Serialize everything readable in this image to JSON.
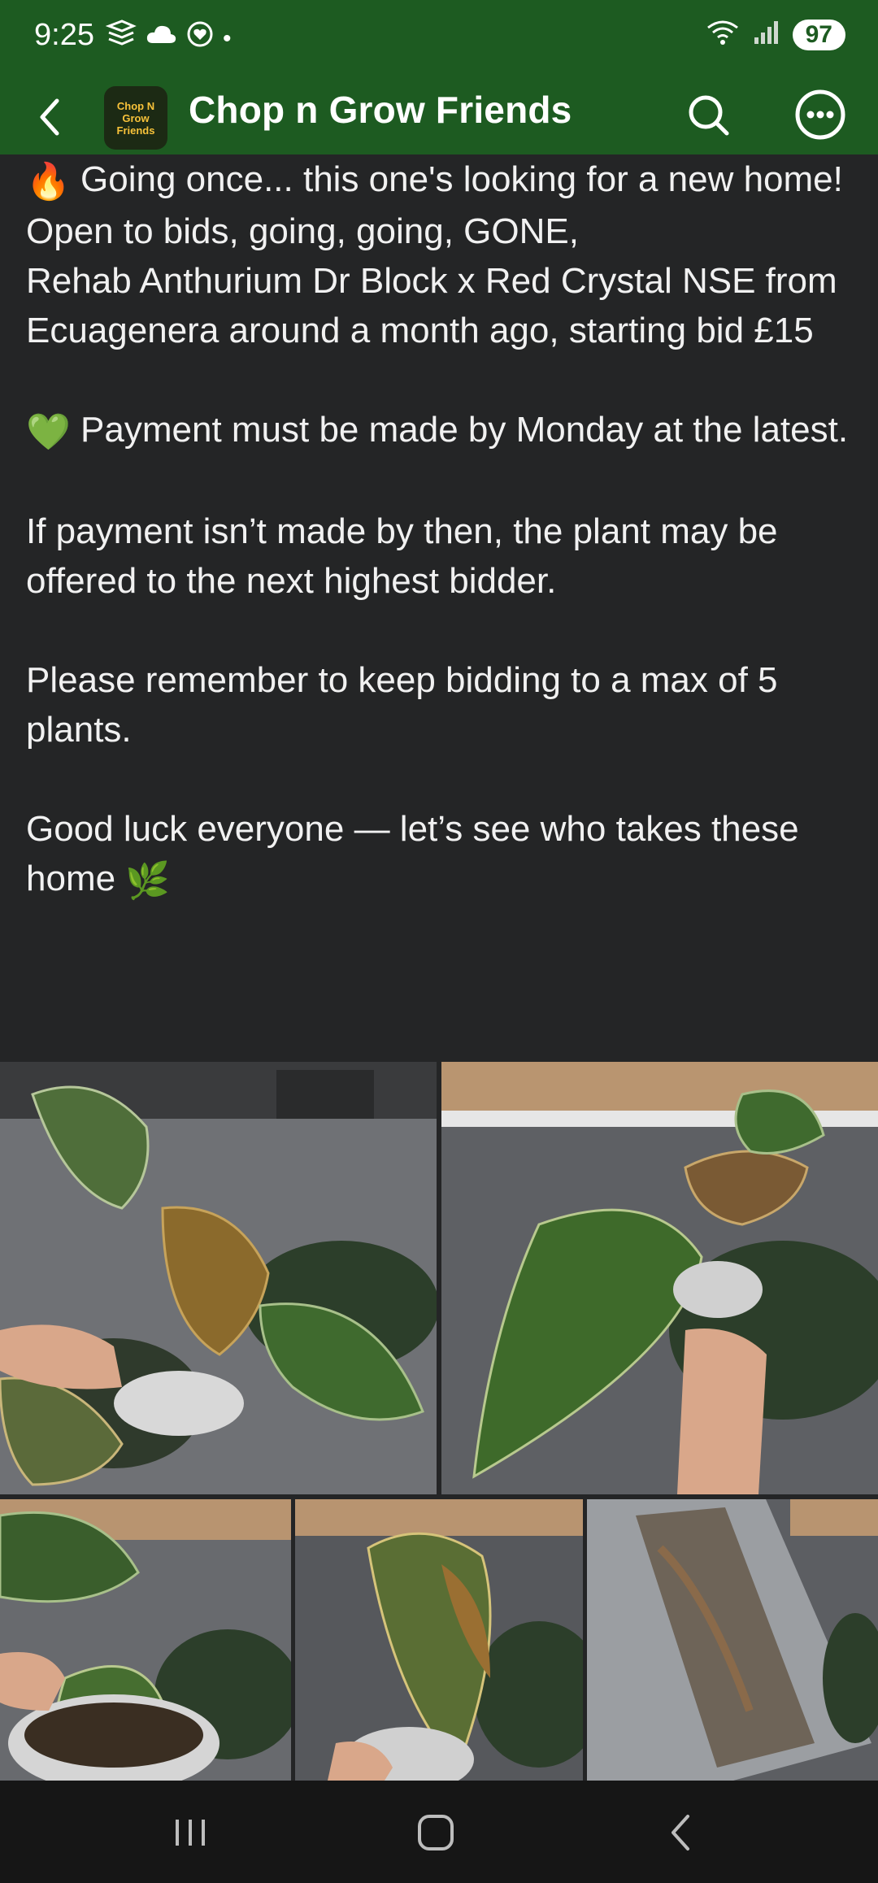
{
  "status_bar": {
    "time": "9:25",
    "battery": "97",
    "dot": "•"
  },
  "header": {
    "title": "Chop n Grow Friends",
    "avatar_text": "Chop N Grow Friends"
  },
  "post": {
    "lines": [
      "Going once... this one's looking for a new home!",
      "Open to bids, going, going, GONE,",
      "Rehab Anthurium Dr Block x Red Crystal NSE from Ecuagenera around a month ago, starting bid £15",
      "Payment must be made by Monday at the latest.",
      "If payment isn’t made by then, the plant may be offered to the next highest bidder.",
      "Please remember to keep bidding to a max of 5 plants.",
      "Good luck everyone — let’s see who takes these home"
    ],
    "emojis": {
      "fire": "🔥",
      "green_heart": "💚",
      "herb": "🌿"
    }
  },
  "photos": [
    "plant-photo-1",
    "plant-photo-2",
    "plant-photo-3",
    "plant-photo-4",
    "plant-photo-5"
  ],
  "icons": {
    "back": "back-arrow-icon",
    "search": "search-icon",
    "more": "more-options-icon",
    "recents": "recent-apps-icon",
    "home": "home-icon",
    "nav_back": "nav-back-icon"
  },
  "colors": {
    "brand_green": "#1d5b21",
    "background": "#242526",
    "text": "#f1f1f1"
  }
}
